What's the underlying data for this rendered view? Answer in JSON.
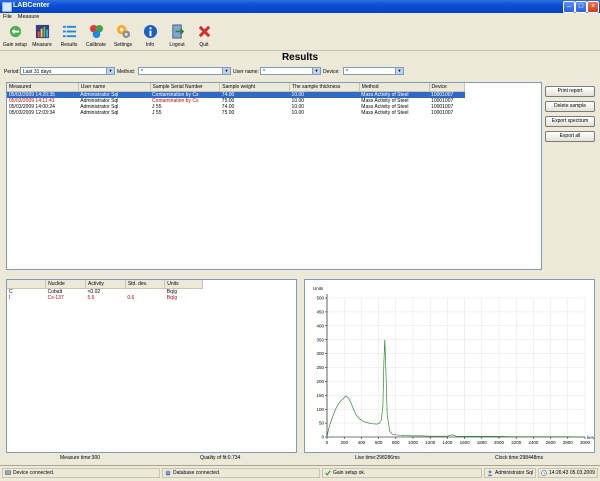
{
  "window": {
    "title": "LABCenter"
  },
  "menu": [
    "File",
    "Measure"
  ],
  "toolbar": [
    {
      "label": "Gain setup",
      "icon": "gain-setup-icon"
    },
    {
      "label": "Measure",
      "icon": "measure-icon"
    },
    {
      "label": "Results",
      "icon": "results-icon"
    },
    {
      "label": "Calibrate",
      "icon": "calibrate-icon"
    },
    {
      "label": "Settings",
      "icon": "settings-icon"
    },
    {
      "label": "Info",
      "icon": "info-icon"
    },
    {
      "label": "Logout",
      "icon": "logout-icon"
    },
    {
      "label": "Quit",
      "icon": "quit-icon"
    }
  ],
  "heading": "Results",
  "filters": {
    "period_label": "Period:",
    "period_value": "Last 31 days",
    "method_label": "Method:",
    "method_value": "*",
    "user_label": "User name:",
    "user_value": "*",
    "device_label": "Device:",
    "device_value": "*"
  },
  "results": {
    "columns": [
      "Measured",
      "User name",
      "Sample Serial Number",
      "Sample weight",
      "The sample thickness",
      "Method",
      "Device"
    ],
    "rows": [
      [
        "05/03/2009 14:20:35",
        "Administrator Sql",
        "Contamination by Cs",
        "74.00",
        "10.00",
        "Mass Activity of Steel",
        "10001007"
      ],
      [
        "05/03/2009 14:11:41",
        "Administrator Sql",
        "Contamination by Cs",
        "75.00",
        "10.00",
        "Mass Activity of Steel",
        "10001007"
      ],
      [
        "05/03/2009 14:00:24",
        "Administrator Sql",
        "J 55",
        "74.00",
        "10.00",
        "Mass Activity of Steel",
        "10001007"
      ],
      [
        "05/03/2009 12:03:34",
        "Administrator Sql",
        "J 55",
        "75.00",
        "10.00",
        "Mass Activity of Steel",
        "10001007"
      ]
    ]
  },
  "buttons": {
    "print": "Print report",
    "delete": "Delete sample",
    "export_spectrum": "Export spectrum",
    "export_all": "Export all"
  },
  "nuclides": {
    "columns": [
      "",
      "Nuclide",
      "Activity",
      "Std. dev.",
      "Units"
    ],
    "rows": [
      [
        "C",
        "Cobalt",
        "<0.02",
        "",
        "Bq/g"
      ],
      [
        "I",
        "Cs-137",
        "5.6",
        "0.6",
        "Bq/g"
      ]
    ]
  },
  "footer": {
    "measure_time": "Measure time:300",
    "quality": "Quality of fit:0.734",
    "live_time": "Live time:298286ms",
    "clock_time": "Clock time:298448ms"
  },
  "status": {
    "device": "Device connected.",
    "database": "Database connected.",
    "gain": "Gain setup ok.",
    "user": "Administrator Sql",
    "datetime": "14:26:43 05.03.2009"
  },
  "colors": {
    "spectrum_line": "#2e8b2e",
    "selection": "#316ac5",
    "red_text": "#c00000"
  },
  "chart_data": {
    "type": "line",
    "title": "",
    "ylabel": "Units",
    "xlabel": "keV",
    "xlim": [
      0,
      3000
    ],
    "ylim": [
      0,
      500
    ],
    "xticks": [
      0,
      200,
      400,
      600,
      800,
      1000,
      1200,
      1400,
      1600,
      1800,
      2000,
      2200,
      2400,
      2600,
      2800,
      3000
    ],
    "yticks": [
      0,
      50,
      100,
      150,
      200,
      250,
      300,
      350,
      400,
      450,
      500
    ],
    "grid": true,
    "series": [
      {
        "name": "",
        "x": [
          0,
          20,
          50,
          80,
          100,
          130,
          160,
          190,
          220,
          250,
          280,
          310,
          340,
          370,
          400,
          430,
          460,
          490,
          520,
          550,
          580,
          610,
          630,
          650,
          662,
          672,
          685,
          700,
          730,
          760,
          800,
          850,
          900,
          1000,
          1100,
          1200,
          1300,
          1400,
          1460,
          1500,
          1600,
          1800,
          2000,
          2200,
          2400,
          2600,
          2800,
          3000
        ],
        "y": [
          0,
          30,
          60,
          85,
          100,
          118,
          130,
          138,
          148,
          140,
          122,
          98,
          80,
          68,
          60,
          55,
          52,
          50,
          48,
          47,
          46,
          50,
          60,
          110,
          270,
          350,
          240,
          80,
          20,
          10,
          8,
          6,
          5,
          4,
          4,
          3,
          3,
          3,
          8,
          3,
          2,
          2,
          2,
          1,
          1,
          1,
          1,
          0
        ]
      }
    ]
  }
}
